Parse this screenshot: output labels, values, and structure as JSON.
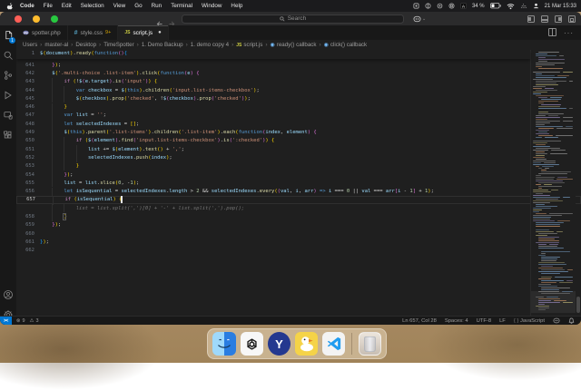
{
  "menu_bar": {
    "items": [
      "Code",
      "File",
      "Edit",
      "Selection",
      "View",
      "Go",
      "Run",
      "Terminal",
      "Window",
      "Help"
    ],
    "battery": "34 %",
    "clock": "21 Mar 15:33"
  },
  "title_bar": {
    "search_placeholder": "Search"
  },
  "tabs": [
    {
      "label": "spotter.php",
      "icon": "php",
      "active": false,
      "badge": "",
      "modified": false
    },
    {
      "label": "style.css",
      "icon": "css",
      "active": false,
      "badge": "9+",
      "modified": false
    },
    {
      "label": "script.js",
      "icon": "js",
      "active": true,
      "badge": "",
      "modified": true
    }
  ],
  "breadcrumbs": [
    {
      "label": "Users"
    },
    {
      "label": "master-al"
    },
    {
      "label": "Desktop"
    },
    {
      "label": "TimeSpotter"
    },
    {
      "label": "1. Demo Backup"
    },
    {
      "label": "1. demo copy 4"
    },
    {
      "label": "script.js",
      "icon": "js"
    },
    {
      "label": "ready() callback",
      "icon": "symbol"
    },
    {
      "label": "click() callback",
      "icon": "symbol"
    }
  ],
  "editor": {
    "sticky": {
      "n": "1",
      "t": [
        [
          "v",
          "$"
        ],
        [
          "g1",
          "("
        ],
        [
          "v",
          "document"
        ],
        [
          "g1",
          ")"
        ],
        [
          "o",
          "."
        ],
        [
          "f",
          "ready"
        ],
        [
          "g1",
          "("
        ],
        [
          "k",
          "function"
        ],
        [
          "g2",
          "()"
        ],
        [
          "g3",
          "{"
        ]
      ]
    },
    "cursor": {
      "row": 16,
      "col": 27
    },
    "lines": [
      {
        "n": "641",
        "t": [
          [
            "o",
            "    "
          ],
          [
            "g2",
            "}"
          ],
          [
            "g1",
            ")"
          ],
          [
            "o",
            ";"
          ]
        ]
      },
      {
        "n": "642",
        "t": [
          [
            "o",
            "    "
          ],
          [
            "v",
            "$"
          ],
          [
            "g1",
            "("
          ],
          [
            "s",
            "'.multi-choice .list-item'"
          ],
          [
            "g1",
            ")"
          ],
          [
            "o",
            "."
          ],
          [
            "f",
            "click"
          ],
          [
            "g1",
            "("
          ],
          [
            "k",
            "function"
          ],
          [
            "g2",
            "("
          ],
          [
            "v",
            "e"
          ],
          [
            "g2",
            ")"
          ],
          [
            "o",
            " "
          ],
          [
            "g2",
            "{"
          ]
        ]
      },
      {
        "n": "643",
        "t": [
          [
            "o",
            "        "
          ],
          [
            "c",
            "if"
          ],
          [
            "o",
            " "
          ],
          [
            "g1",
            "("
          ],
          [
            "o",
            "!"
          ],
          [
            "v",
            "$"
          ],
          [
            "g2",
            "("
          ],
          [
            "v",
            "e"
          ],
          [
            "o",
            "."
          ],
          [
            "v",
            "target"
          ],
          [
            "g2",
            ")"
          ],
          [
            "o",
            "."
          ],
          [
            "f",
            "is"
          ],
          [
            "g2",
            "("
          ],
          [
            "s",
            "'input'"
          ],
          [
            "g2",
            ")"
          ],
          [
            "g1",
            ")"
          ],
          [
            "o",
            " "
          ],
          [
            "g1",
            "{"
          ]
        ]
      },
      {
        "n": "644",
        "t": [
          [
            "o",
            "            "
          ],
          [
            "k",
            "var"
          ],
          [
            "o",
            " "
          ],
          [
            "v",
            "checkbox"
          ],
          [
            "o",
            " = "
          ],
          [
            "v",
            "$"
          ],
          [
            "g1",
            "("
          ],
          [
            "k",
            "this"
          ],
          [
            "g1",
            ")"
          ],
          [
            "o",
            "."
          ],
          [
            "f",
            "children"
          ],
          [
            "g1",
            "("
          ],
          [
            "s",
            "'input.list-items-checkbox'"
          ],
          [
            "g1",
            ")"
          ],
          [
            "o",
            ";"
          ]
        ]
      },
      {
        "n": "645",
        "t": [
          [
            "o",
            "            "
          ],
          [
            "v",
            "$"
          ],
          [
            "g1",
            "("
          ],
          [
            "v",
            "checkbox"
          ],
          [
            "g1",
            ")"
          ],
          [
            "o",
            "."
          ],
          [
            "f",
            "prop"
          ],
          [
            "g1",
            "("
          ],
          [
            "s",
            "'checked'"
          ],
          [
            "o",
            ", !"
          ],
          [
            "v",
            "$"
          ],
          [
            "g2",
            "("
          ],
          [
            "v",
            "checkbox"
          ],
          [
            "g2",
            ")"
          ],
          [
            "o",
            "."
          ],
          [
            "f",
            "prop"
          ],
          [
            "g2",
            "("
          ],
          [
            "s",
            "'checked'"
          ],
          [
            "g2",
            ")"
          ],
          [
            "g1",
            ")"
          ],
          [
            "o",
            ";"
          ]
        ]
      },
      {
        "n": "646",
        "t": [
          [
            "o",
            "        "
          ],
          [
            "g1",
            "}"
          ]
        ]
      },
      {
        "n": "647",
        "t": [
          [
            "o",
            "        "
          ],
          [
            "k",
            "var"
          ],
          [
            "o",
            " "
          ],
          [
            "v",
            "list"
          ],
          [
            "o",
            " = "
          ],
          [
            "s",
            "''"
          ],
          [
            "o",
            ";"
          ]
        ]
      },
      {
        "n": "648",
        "t": [
          [
            "o",
            "        "
          ],
          [
            "k",
            "let"
          ],
          [
            "o",
            " "
          ],
          [
            "v",
            "selectedIndexes"
          ],
          [
            "o",
            " = "
          ],
          [
            "g1",
            "[]"
          ],
          [
            "o",
            ";"
          ]
        ]
      },
      {
        "n": "649",
        "t": [
          [
            "o",
            "        "
          ],
          [
            "v",
            "$"
          ],
          [
            "g1",
            "("
          ],
          [
            "k",
            "this"
          ],
          [
            "g1",
            ")"
          ],
          [
            "o",
            "."
          ],
          [
            "f",
            "parent"
          ],
          [
            "g1",
            "("
          ],
          [
            "s",
            "'.list-items'"
          ],
          [
            "g1",
            ")"
          ],
          [
            "o",
            "."
          ],
          [
            "f",
            "children"
          ],
          [
            "g1",
            "("
          ],
          [
            "s",
            "'.list-item'"
          ],
          [
            "g1",
            ")"
          ],
          [
            "o",
            "."
          ],
          [
            "f",
            "each"
          ],
          [
            "g1",
            "("
          ],
          [
            "k",
            "function"
          ],
          [
            "g2",
            "("
          ],
          [
            "v",
            "index"
          ],
          [
            "o",
            ", "
          ],
          [
            "v",
            "element"
          ],
          [
            "g2",
            ")"
          ],
          [
            "o",
            " "
          ],
          [
            "g2",
            "{"
          ]
        ]
      },
      {
        "n": "650",
        "t": [
          [
            "o",
            "            "
          ],
          [
            "c",
            "if"
          ],
          [
            "o",
            " "
          ],
          [
            "g1",
            "("
          ],
          [
            "v",
            "$"
          ],
          [
            "g2",
            "("
          ],
          [
            "v",
            "element"
          ],
          [
            "g2",
            ")"
          ],
          [
            "o",
            "."
          ],
          [
            "f",
            "find"
          ],
          [
            "g2",
            "("
          ],
          [
            "s",
            "'input.list-items-checkbox'"
          ],
          [
            "g2",
            ")"
          ],
          [
            "o",
            "."
          ],
          [
            "f",
            "is"
          ],
          [
            "g2",
            "("
          ],
          [
            "s",
            "':checked'"
          ],
          [
            "g2",
            ")"
          ],
          [
            "g1",
            ")"
          ],
          [
            "o",
            " "
          ],
          [
            "g1",
            "{"
          ]
        ]
      },
      {
        "n": "651",
        "t": [
          [
            "o",
            "                "
          ],
          [
            "v",
            "list"
          ],
          [
            "o",
            " += "
          ],
          [
            "v",
            "$"
          ],
          [
            "g1",
            "("
          ],
          [
            "v",
            "element"
          ],
          [
            "g1",
            ")"
          ],
          [
            "o",
            "."
          ],
          [
            "f",
            "text"
          ],
          [
            "g1",
            "()"
          ],
          [
            "o",
            " + "
          ],
          [
            "s",
            "','"
          ],
          [
            "o",
            ";"
          ]
        ]
      },
      {
        "n": "652",
        "t": [
          [
            "o",
            "                "
          ],
          [
            "v",
            "selectedIndexes"
          ],
          [
            "o",
            "."
          ],
          [
            "f",
            "push"
          ],
          [
            "g1",
            "("
          ],
          [
            "v",
            "index"
          ],
          [
            "g1",
            ")"
          ],
          [
            "o",
            ";"
          ]
        ]
      },
      {
        "n": "653",
        "t": [
          [
            "o",
            "            "
          ],
          [
            "g1",
            "}"
          ]
        ]
      },
      {
        "n": "654",
        "t": [
          [
            "o",
            "        "
          ],
          [
            "g2",
            "}"
          ],
          [
            "g1",
            ")"
          ],
          [
            "o",
            ";"
          ]
        ]
      },
      {
        "n": "655",
        "t": [
          [
            "o",
            "        "
          ],
          [
            "v",
            "list"
          ],
          [
            "o",
            " = "
          ],
          [
            "v",
            "list"
          ],
          [
            "o",
            "."
          ],
          [
            "f",
            "slice"
          ],
          [
            "g1",
            "("
          ],
          [
            "n2",
            "0"
          ],
          [
            "o",
            ", -"
          ],
          [
            "n2",
            "1"
          ],
          [
            "g1",
            ")"
          ],
          [
            "o",
            ";"
          ]
        ]
      },
      {
        "n": "656",
        "t": [
          [
            "o",
            "        "
          ],
          [
            "k",
            "let"
          ],
          [
            "o",
            " "
          ],
          [
            "v",
            "isSequential"
          ],
          [
            "o",
            " = "
          ],
          [
            "v",
            "selectedIndexes"
          ],
          [
            "o",
            "."
          ],
          [
            "v",
            "length"
          ],
          [
            "o",
            " > "
          ],
          [
            "n2",
            "2"
          ],
          [
            "o",
            " && "
          ],
          [
            "v",
            "selectedIndexes"
          ],
          [
            "o",
            "."
          ],
          [
            "f",
            "every"
          ],
          [
            "g1",
            "("
          ],
          [
            "g2",
            "("
          ],
          [
            "v",
            "val"
          ],
          [
            "o",
            ", "
          ],
          [
            "v",
            "i"
          ],
          [
            "o",
            ", "
          ],
          [
            "v",
            "arr"
          ],
          [
            "g2",
            ")"
          ],
          [
            "k",
            " => "
          ],
          [
            "v",
            "i"
          ],
          [
            "o",
            " === "
          ],
          [
            "n2",
            "0"
          ],
          [
            "o",
            " || "
          ],
          [
            "v",
            "val"
          ],
          [
            "o",
            " === "
          ],
          [
            "v",
            "arr"
          ],
          [
            "g2",
            "["
          ],
          [
            "v",
            "i"
          ],
          [
            "o",
            " - "
          ],
          [
            "n2",
            "1"
          ],
          [
            "g2",
            "]"
          ],
          [
            "o",
            " + "
          ],
          [
            "n2",
            "1"
          ],
          [
            "g1",
            ")"
          ],
          [
            "o",
            ";"
          ]
        ]
      },
      {
        "n": "657",
        "cur": true,
        "t": [
          [
            "o",
            "        "
          ],
          [
            "c",
            "if"
          ],
          [
            "o",
            " "
          ],
          [
            "g1",
            "("
          ],
          [
            "v",
            "isSequential"
          ],
          [
            "g1",
            ")"
          ],
          [
            "o",
            " "
          ],
          [
            "g1",
            "{"
          ]
        ]
      },
      {
        "n": "",
        "ghost": true,
        "t": [
          [
            "gh",
            "            list = list.split(',')[0] + '-' + list.split(',').pop();"
          ]
        ]
      },
      {
        "n": "658",
        "t": [
          [
            "o",
            "        "
          ],
          [
            "g1",
            "}"
          ]
        ]
      },
      {
        "n": "659",
        "t": [
          [
            "o",
            "    "
          ],
          [
            "g2",
            "}"
          ],
          [
            "g1",
            ")"
          ],
          [
            "o",
            ";"
          ]
        ]
      },
      {
        "n": "660",
        "t": []
      },
      {
        "n": "661",
        "t": [
          [
            "g3",
            "}"
          ],
          [
            "g1",
            ")"
          ],
          [
            "o",
            ";"
          ]
        ]
      },
      {
        "n": "662",
        "t": []
      }
    ]
  },
  "status_bar": {
    "errors": "9",
    "warnings": "3",
    "line_col": "Ln 657, Col 28",
    "spaces": "Spaces: 4",
    "encoding": "UTF-8",
    "eol": "LF",
    "language": "JavaScript"
  },
  "dock": {
    "items": [
      "finder",
      "chatgpt",
      "yandex",
      "cyberduck",
      "vscode",
      "trash"
    ]
  }
}
